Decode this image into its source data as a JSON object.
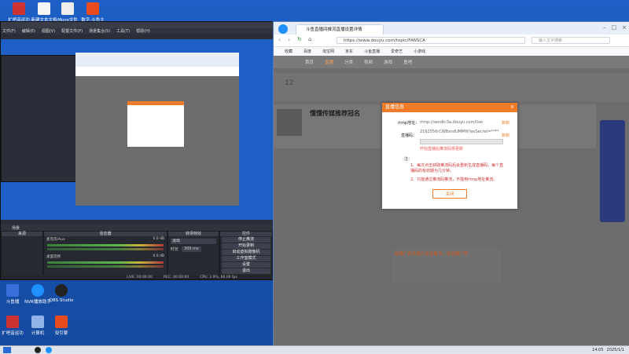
{
  "desktop": {
    "icons_top": [
      "扩吧音运功",
      "新建文本文档",
      "Micro文件",
      "数字-斗鱼主"
    ],
    "icons_mid": [
      "斗鱼播",
      "NVR播放助手",
      "OBS Studio"
    ],
    "icons_bottom": [
      "扩吧音运功",
      "计算机",
      "双引擎"
    ]
  },
  "obs": {
    "menu": [
      "文件(F)",
      "编辑(E)",
      "视图(V)",
      "配置文件(P)",
      "场景集合(S)",
      "工具(T)",
      "帮助(H)"
    ],
    "scenes_label": "场景",
    "sources_label": "来源",
    "mixer_label": "混音器",
    "transition_label": "转场特效",
    "controls_label": "控件",
    "mixer": [
      {
        "name": "桌面音频",
        "value": "0.0 dB"
      },
      {
        "name": "麦克风/Aux",
        "value": "0.0 dB"
      }
    ],
    "transition_value": "淡出",
    "duration_label": "时长",
    "duration_value": "300 ms",
    "controls": [
      "停止推流",
      "开始录制",
      "启动虚拟摄像机",
      "工作室模式",
      "设置",
      "退出"
    ],
    "status": [
      "LIVE: 00:00:00",
      "REC: 00:00:00",
      "CPU: 3.9%, 60.00 fps"
    ],
    "colors": {
      "accent": "#f07c2a",
      "panel": "#262930"
    }
  },
  "browser": {
    "tab_title": "斗鱼直播间推流直播设置详情",
    "url": "https://www.douyu.com/topic/FANSCA",
    "search_placeholder": "输入文字搜索",
    "bookmarks": [
      "收藏",
      "百度",
      "淘宝网",
      "京东",
      "斗鱼直播",
      "爱奇艺",
      "小游戏"
    ],
    "site_nav": [
      "首页",
      "直播",
      "分类",
      "视频",
      "游戏",
      "鱼吧"
    ],
    "streamer_name": "懂懂传媒推荐冠名",
    "streamer_count": "12",
    "promo": "前推广的手游少女征集令，欢迎推广吧",
    "modal": {
      "title": "直播信息",
      "rtmp_label": "rtmp地址：",
      "rtmp_value": "rtmp://sendtc3a.douyu.com/live",
      "code_label": "直播码：",
      "code_value": "2162556rCWBsndUMMN?wsSecret=******",
      "copy": "复制",
      "hint": "开始直播后推流码将更新",
      "note_title": "注：",
      "notes": [
        "1、每次点击获取推流码后会重新生成直播码，每个直播码的有效期为几分钟。",
        "2、只能通过推流码推流，不能用rtmp地址推流。"
      ],
      "close": "关闭"
    }
  },
  "taskbar": {
    "time": "14:05",
    "date": "2025/1/1"
  }
}
